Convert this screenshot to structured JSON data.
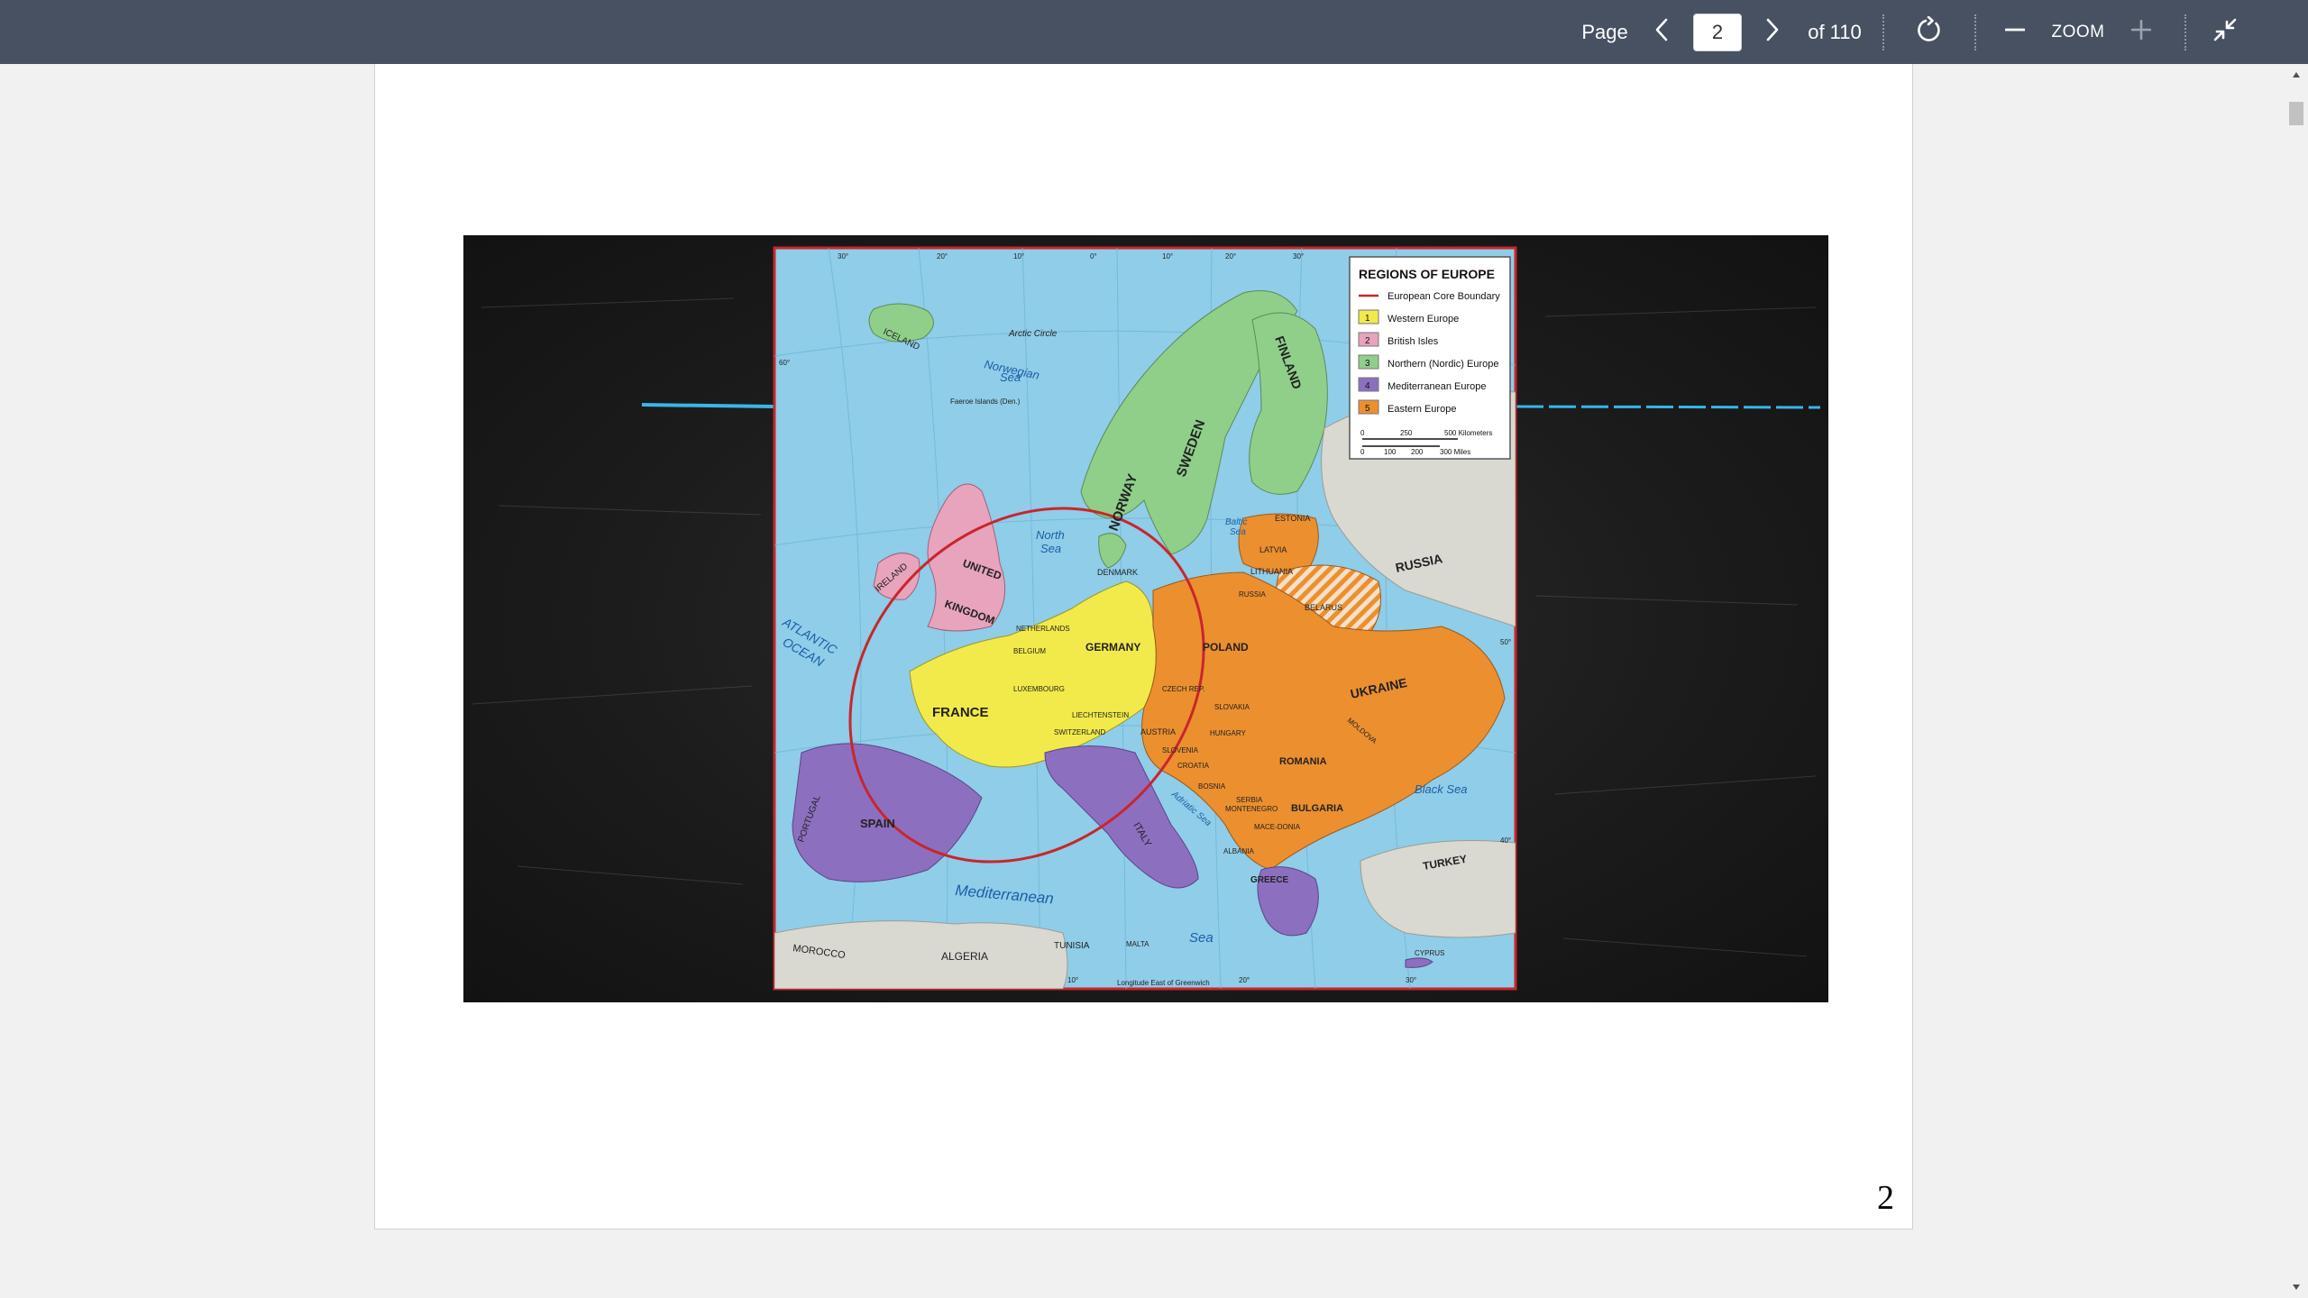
{
  "toolbar": {
    "page_label": "Page",
    "page_value": "2",
    "of_label": "of 110",
    "zoom_label": "ZOOM",
    "icons": {
      "prev": "chevron-left-icon",
      "next": "chevron-right-icon",
      "rotate": "rotate-icon",
      "zoom_out": "minus-icon",
      "zoom_in": "plus-icon",
      "collapse": "collapse-icon"
    },
    "colors": {
      "background": "#475161",
      "text": "#ffffff"
    }
  },
  "document": {
    "page_number": "2"
  },
  "map": {
    "legend": {
      "title": "REGIONS OF EUROPE",
      "items": [
        {
          "num": "",
          "label": "European Core Boundary",
          "color": "#c8262c"
        },
        {
          "num": "1",
          "label": "Western Europe",
          "color": "#f2ea4a"
        },
        {
          "num": "2",
          "label": "British Isles",
          "color": "#e8a3bd"
        },
        {
          "num": "3",
          "label": "Northern (Nordic) Europe",
          "color": "#8fcf8a"
        },
        {
          "num": "4",
          "label": "Mediterranean Europe",
          "color": "#8d6fc0"
        },
        {
          "num": "5",
          "label": "Eastern Europe",
          "color": "#ec8f2f"
        }
      ],
      "scale_km": "500 Kilometers",
      "scale_mi": "300 Miles",
      "scale_km_ticks": [
        "0",
        "250"
      ],
      "scale_mi_ticks": [
        "0",
        "100",
        "200"
      ]
    },
    "labels": {
      "iceland": "ICELAND",
      "arctic": "Arctic Circle",
      "norwegian_sea": "Norwegian",
      "norwegian_sea2": "Sea",
      "faroe": "Faeroe Islands (Den.)",
      "norway": "NORWAY",
      "sweden": "SWEDEN",
      "finland": "FINLAND",
      "north_sea": "North",
      "north_sea2": "Sea",
      "baltic": "Baltic",
      "baltic2": "Sea",
      "denmark": "DENMARK",
      "estonia": "ESTONIA",
      "latvia": "LATVIA",
      "lithuania": "LITHUANIA",
      "russia_small": "RUSSIA",
      "belarus": "BELARUS",
      "russia": "RUSSIA",
      "ireland": "IRELAND",
      "uk1": "UNITED",
      "uk2": "KINGDOM",
      "atlantic1": "ATLANTIC",
      "atlantic2": "OCEAN",
      "netherlands": "NETHERLANDS",
      "belgium": "BELGIUM",
      "luxembourg": "LUXEMBOURG",
      "germany": "GERMANY",
      "poland": "POLAND",
      "czech": "CZECH REP.",
      "slovakia": "SLOVAKIA",
      "ukraine": "UKRAINE",
      "moldova": "MOLDOVA",
      "france": "FRANCE",
      "liechtenstein": "LIECHTENSTEIN",
      "switzerland": "SWITZERLAND",
      "austria": "AUSTRIA",
      "hungary": "HUNGARY",
      "slovenia": "SLOVENIA",
      "croatia": "CROATIA",
      "romania": "ROMANIA",
      "bosnia": "BOSNIA",
      "serbia": "SERBIA",
      "montenegro": "MONTENEGRO",
      "bulgaria": "BULGARIA",
      "macedonia": "MACE-DONIA",
      "albania": "ALBANIA",
      "greece": "GREECE",
      "black_sea": "Black Sea",
      "portugal": "PORTUGAL",
      "spain": "SPAIN",
      "italy": "ITALY",
      "adriatic": "Adriatic Sea",
      "mediterranean": "Mediterranean",
      "sea": "Sea",
      "turkey": "TURKEY",
      "cyprus": "CYPRUS",
      "morocco": "MOROCCO",
      "algeria": "ALGERIA",
      "tunisia": "TUNISIA",
      "malta": "MALTA",
      "longitude_note": "Longitude East of Greenwich"
    },
    "lon_ticks_top": [
      "30°",
      "20°",
      "10°",
      "0°",
      "10°",
      "20°",
      "30°"
    ],
    "lon_ticks_bottom": [
      "10°",
      "20°",
      "30°"
    ],
    "lat_ticks": [
      "60°",
      "50°",
      "40°"
    ]
  }
}
